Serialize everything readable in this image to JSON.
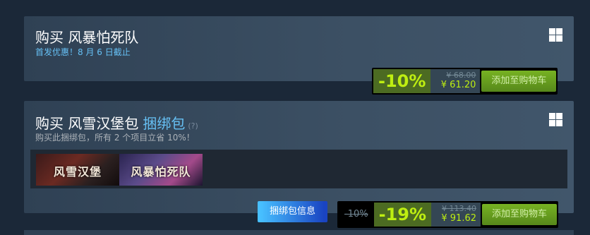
{
  "offer1": {
    "title": "购买 风暴怕死队",
    "subtitle": "首发优惠！8 月 6 日截止",
    "discount_pct": "-10%",
    "original_price": "¥ 68.00",
    "final_price": "¥ 61.20",
    "cart_label": "添加至购物车",
    "platform_icon": "windows-icon"
  },
  "offer2": {
    "title": "购买 风雪汉堡包",
    "bundle_label": "捆绑包",
    "help_mark": "(?)",
    "subtitle": "购买此捆绑包，所有 2 个项目立省 10%！",
    "items": [
      {
        "art_text": "风雪汉堡"
      },
      {
        "art_text": "风暴怕死队"
      }
    ],
    "info_label": "捆绑包信息",
    "base_discount": "-10%",
    "discount_pct": "-19%",
    "original_price": "¥ 113.40",
    "final_price": "¥ 91.62",
    "cart_label": "添加至购物车",
    "platform_icon": "windows-icon"
  },
  "colors": {
    "accent_green": "#beee11",
    "link_blue": "#66c0f4",
    "panel": "#3c5064",
    "background": "#1b2838"
  }
}
